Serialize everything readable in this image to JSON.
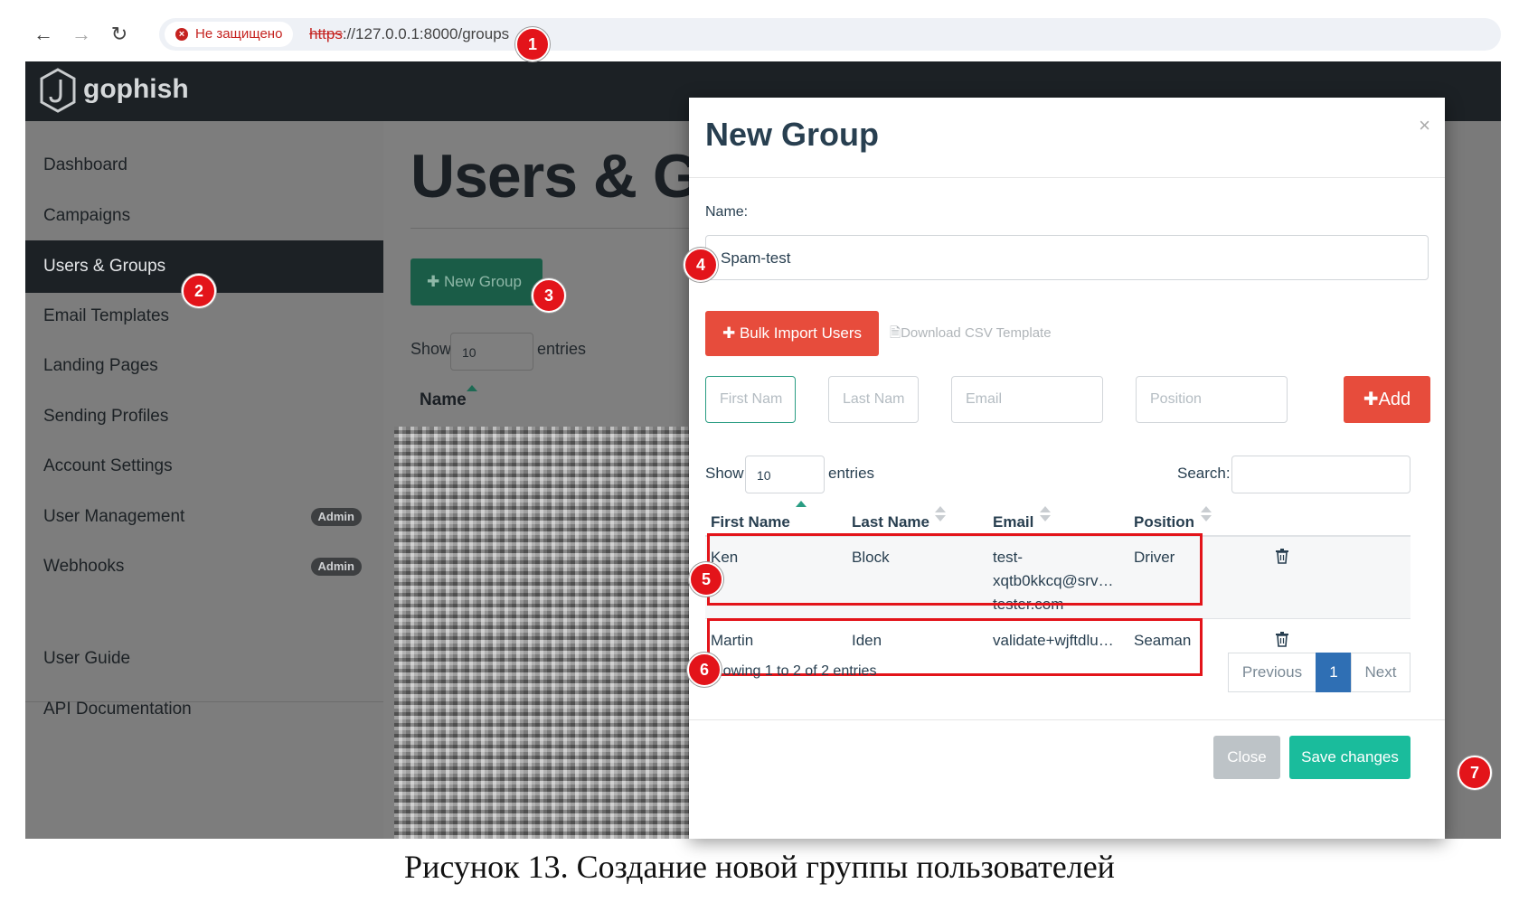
{
  "browser": {
    "security_label": "Не защищено",
    "url_protocol": "https",
    "url_rest": "://127.0.0.1:8000/groups"
  },
  "app": {
    "logo_text": "gophish"
  },
  "sidebar": {
    "items": [
      {
        "label": "Dashboard"
      },
      {
        "label": "Campaigns"
      },
      {
        "label": "Users & Groups"
      },
      {
        "label": "Email Templates"
      },
      {
        "label": "Landing Pages"
      },
      {
        "label": "Sending Profiles"
      },
      {
        "label": "Account Settings"
      },
      {
        "label": "User Management",
        "badge": "Admin"
      },
      {
        "label": "Webhooks",
        "badge": "Admin"
      }
    ],
    "bottom_items": [
      {
        "label": "User Guide"
      },
      {
        "label": "API Documentation"
      }
    ]
  },
  "page": {
    "title": "Users & G",
    "new_group_label": "New Group",
    "show_label": "Show",
    "show_value": "10",
    "entries_label": "entries",
    "column_name": "Name"
  },
  "modal": {
    "title": "New Group",
    "close_symbol": "×",
    "name_label": "Name:",
    "name_value": "Spam-test",
    "bulk_import_label": "Bulk Import Users",
    "download_csv_label": "Download CSV Template",
    "first_name_placeholder": "First Nam",
    "last_name_placeholder": "Last Nam",
    "email_placeholder": "Email",
    "position_placeholder": "Position",
    "add_label": "Add",
    "show_label": "Show",
    "show_value": "10",
    "entries_label": "entries",
    "search_label": "Search:",
    "columns": [
      "First Name",
      "Last Name",
      "Email",
      "Position"
    ],
    "rows": [
      {
        "first": "Ken",
        "last": "Block",
        "email": "test-xqtb0kkcq@srv…tester.com",
        "email_l1": "test-",
        "email_l2": "xqtb0kkcq@srv…",
        "email_l3": "tester.com",
        "position": "Driver"
      },
      {
        "first": "Martin",
        "last": "Iden",
        "email": "validate+wjftdlu…",
        "position": "Seaman"
      }
    ],
    "showing_text": "Showing 1 to 2 of 2 entries",
    "pager_previous": "Previous",
    "pager_current": "1",
    "pager_next": "Next",
    "close_button": "Close",
    "save_button": "Save changes"
  },
  "markers": [
    "1",
    "2",
    "3",
    "4",
    "5",
    "6",
    "7"
  ],
  "caption": "Рисунок 13. Создание новой группы пользователей",
  "colors": {
    "topnav": "#1c2125",
    "danger": "#e74c3c",
    "success": "#1abc9c",
    "primary": "#2f6fb4",
    "marker": "#e3141a"
  }
}
